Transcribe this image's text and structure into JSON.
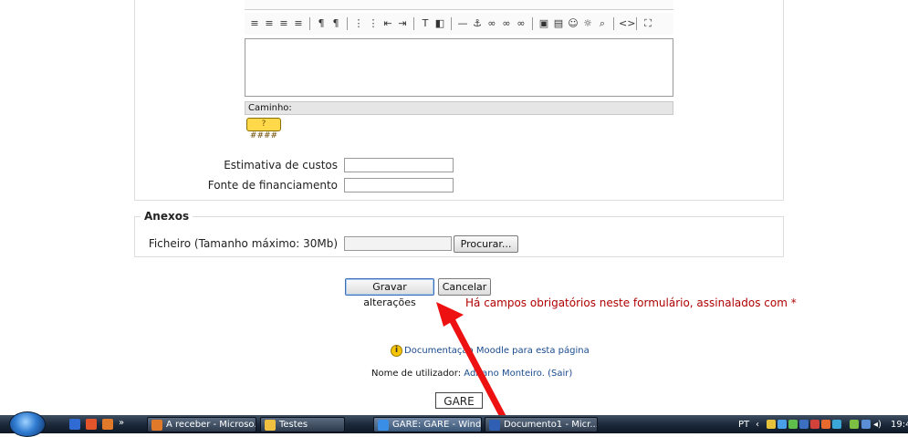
{
  "editor": {
    "path_label": "Caminho:",
    "help_button_label": "? ####",
    "toolbar_icons": [
      "align-left-icon",
      "align-center-icon",
      "align-right-icon",
      "align-justify-icon",
      "sep",
      "ltr-icon",
      "rtl-icon",
      "sep",
      "ordered-list-icon",
      "unordered-list-icon",
      "outdent-icon",
      "indent-icon",
      "sep",
      "text-color-icon",
      "background-color-icon",
      "sep",
      "horizontal-rule-icon",
      "anchor-icon",
      "link-icon",
      "unlink-icon",
      "no-link-icon",
      "sep",
      "image-icon",
      "table-icon",
      "smiley-icon",
      "special-char-icon",
      "search-replace-icon",
      "sep",
      "html-source-icon",
      "sep",
      "fullscreen-icon"
    ],
    "toolbar_glyphs": [
      "≡",
      "≡",
      "≡",
      "≡",
      "|",
      "¶",
      "¶",
      "|",
      "⋮",
      "⋮",
      "⇤",
      "⇥",
      "|",
      "T",
      "◧",
      "|",
      "—",
      "⚓",
      "∞",
      "∞",
      "∞",
      "|",
      "▣",
      "▤",
      "☺",
      "☼",
      "⌕",
      "|",
      "<>",
      "|",
      "⛶"
    ]
  },
  "form": {
    "cost_label": "Estimativa de custos",
    "cost_value": "",
    "funding_label": "Fonte de financiamento",
    "funding_value": ""
  },
  "attachments": {
    "legend": "Anexos",
    "file_label": "Ficheiro (Tamanho máximo: 30Mb)",
    "file_value": "",
    "browse_label": "Procurar..."
  },
  "actions": {
    "save_label": "Gravar alterações",
    "cancel_label": "Cancelar",
    "required_note": "Há campos obrigatórios neste formulário, assinalados com *"
  },
  "footer": {
    "doc_link": "Documentação Moodle para esta página",
    "user_prefix": "Nome de utilizador:",
    "user_name": "Adriano Monteiro.",
    "logout": "(Sair)",
    "home_label": "GARE"
  },
  "taskbar": {
    "tasks": [
      {
        "label": "A receber - Microso...",
        "icon_color": "#e07a2a"
      },
      {
        "label": "Testes",
        "icon_color": "#f0c040"
      },
      {
        "label": "GARE: GARE - Wind...",
        "icon_color": "#3a8ee6"
      },
      {
        "label": "Documento1 - Micr...",
        "icon_color": "#2f5fb3"
      }
    ],
    "language": "PT",
    "clock": "19:4"
  },
  "colors": {
    "required": "#b00000",
    "link": "#1a4b8f",
    "arrow": "#ee1111"
  }
}
